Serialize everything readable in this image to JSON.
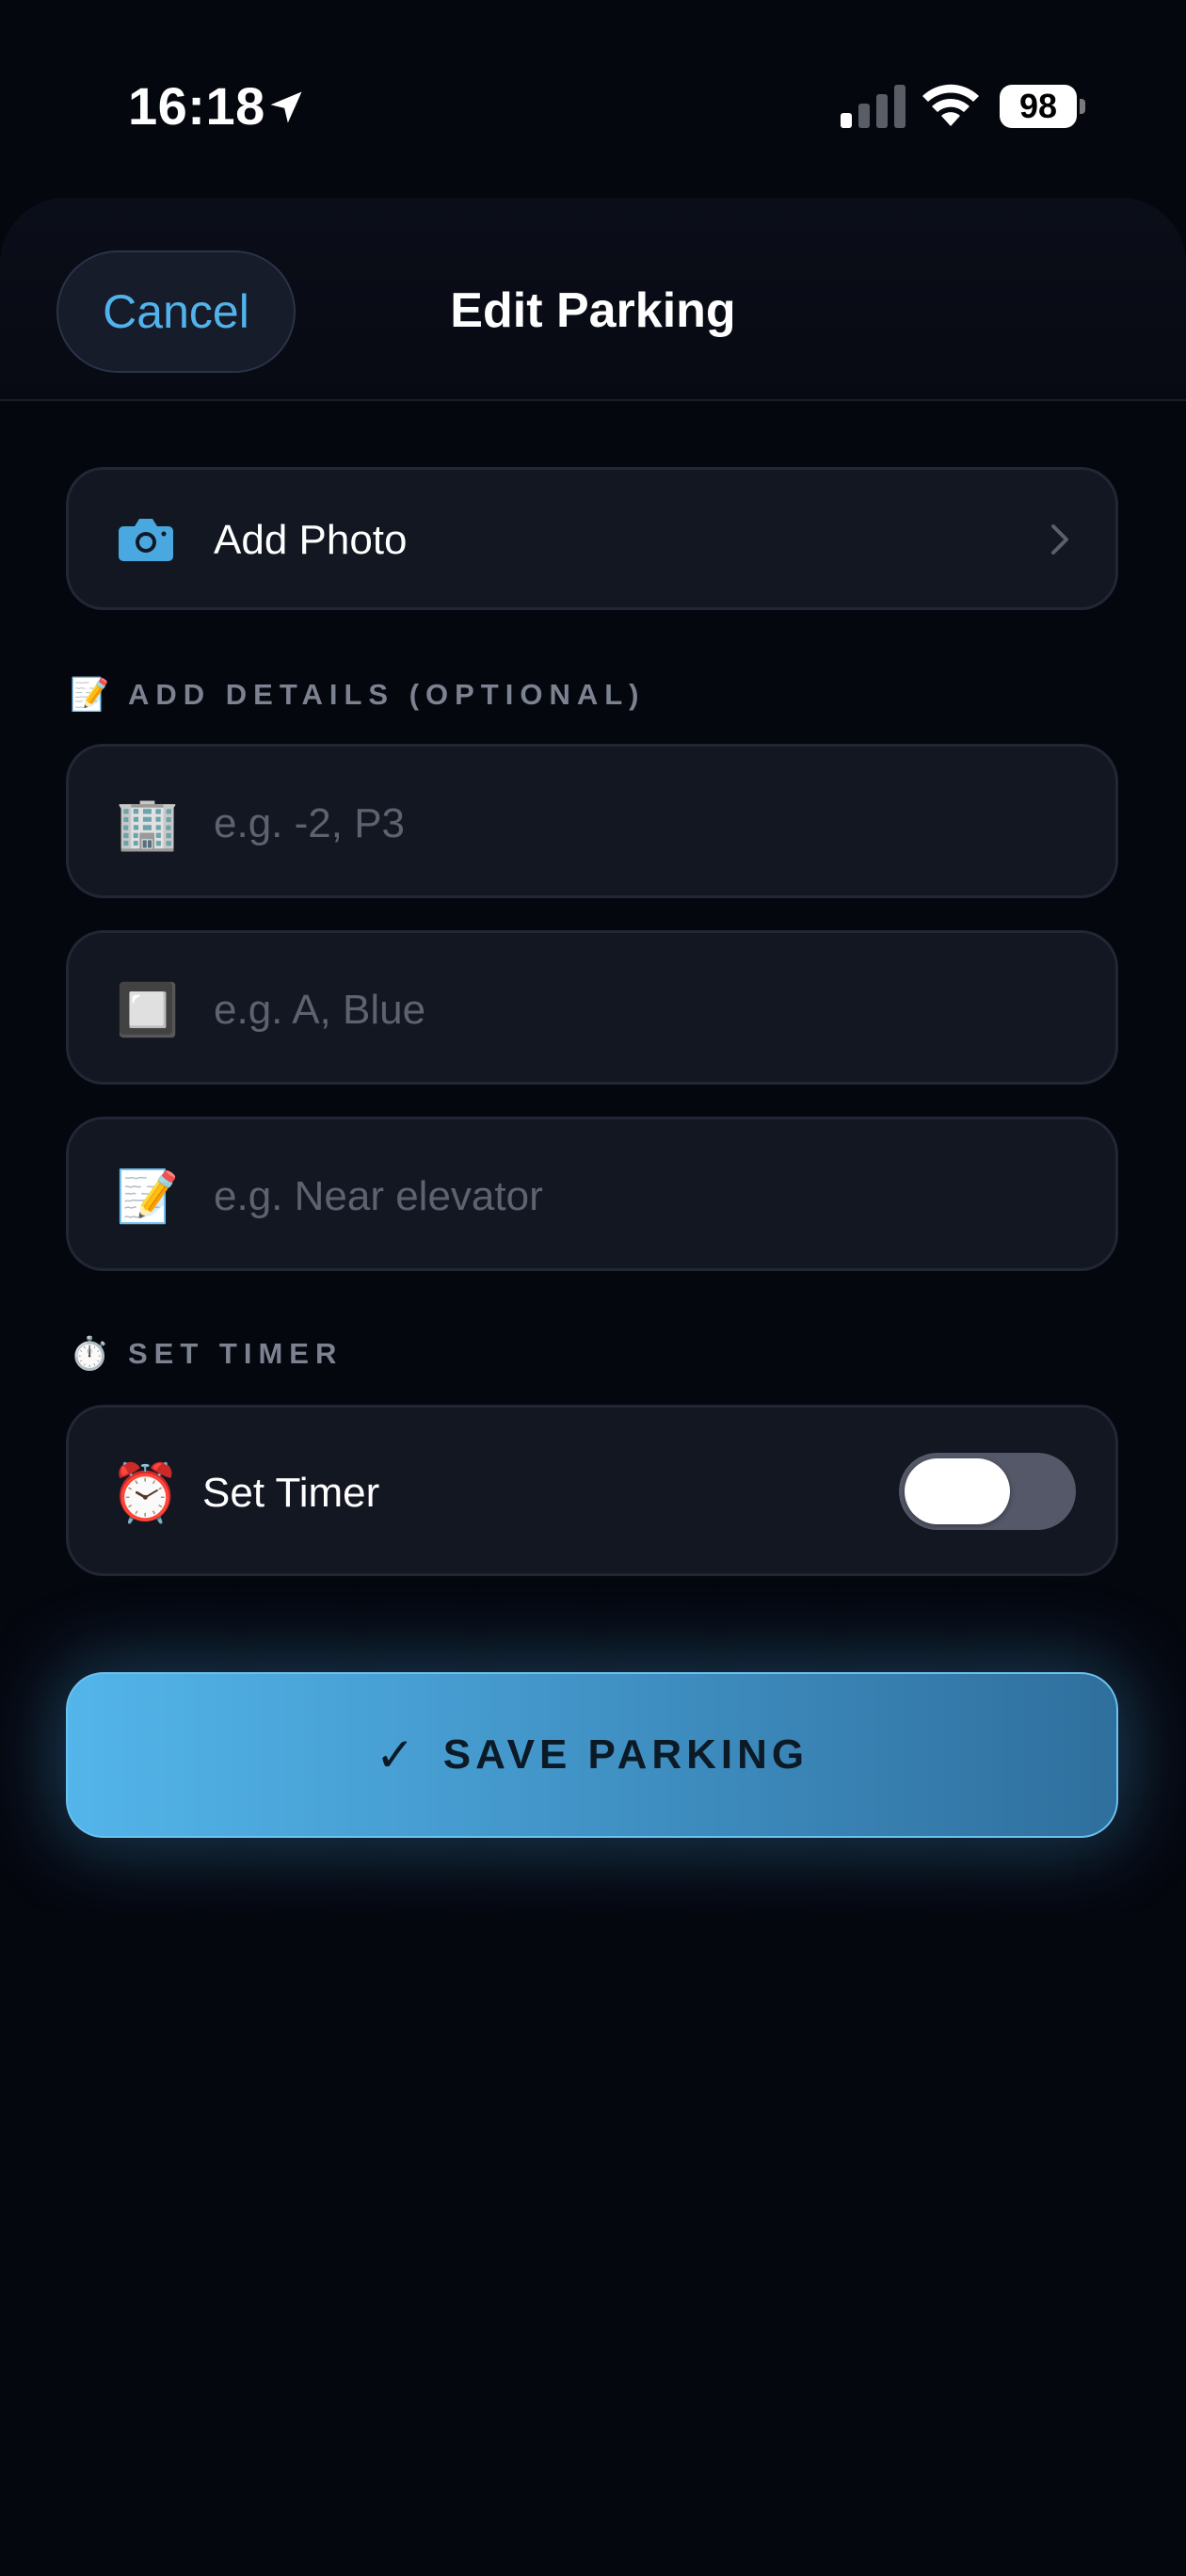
{
  "status_bar": {
    "time": "16:18",
    "battery": "98",
    "icons": [
      "location-arrow-icon",
      "signal-icon",
      "wifi-icon",
      "battery-icon"
    ]
  },
  "header": {
    "cancel_label": "Cancel",
    "title": "Edit Parking"
  },
  "photo": {
    "label": "Add Photo",
    "icon": "camera-icon"
  },
  "details": {
    "section_emoji": "📝",
    "section_label": "ADD DETAILS (OPTIONAL)",
    "fields": [
      {
        "emoji": "🏢",
        "value": "",
        "placeholder": "e.g. -2, P3"
      },
      {
        "emoji": "🔲",
        "value": "",
        "placeholder": "e.g. A, Blue"
      },
      {
        "emoji": "📝",
        "value": "",
        "placeholder": "e.g. Near elevator"
      }
    ]
  },
  "timer": {
    "section_emoji": "⏱️",
    "section_label": "SET TIMER",
    "row_emoji": "⏰",
    "row_label": "Set Timer",
    "enabled": false
  },
  "save": {
    "check": "✓",
    "label": "SAVE PARKING"
  },
  "colors": {
    "background": "#05070f",
    "accent": "#52b3ec",
    "card": "#131722"
  }
}
